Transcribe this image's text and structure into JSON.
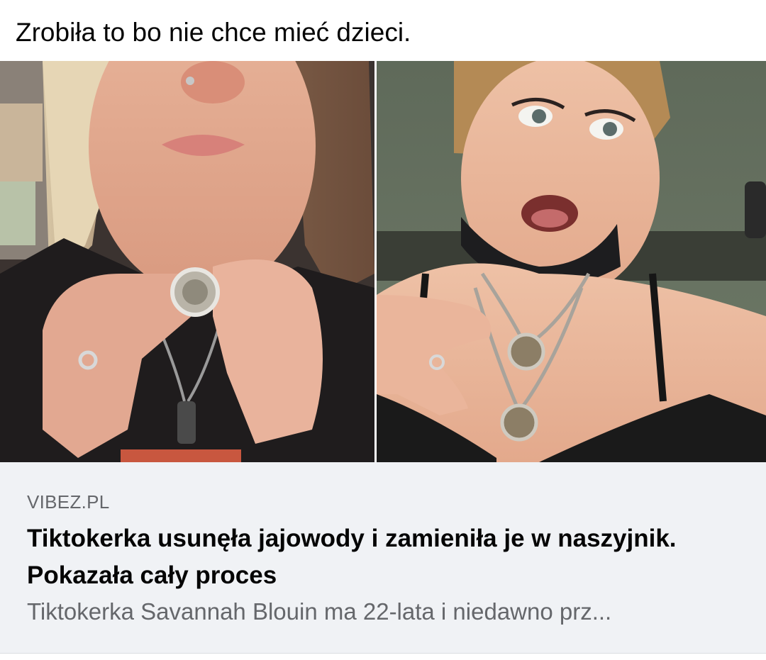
{
  "post": {
    "caption": "Zrobiła to bo nie chce mieć dzieci."
  },
  "media": {
    "left_image_icon": "photo-woman-holding-pendant",
    "right_image_icon": "photo-woman-surprised-necklace"
  },
  "link_card": {
    "domain": "VIBEZ.PL",
    "title": "Tiktokerka usunęła jajowody i zamieniła je w naszyjnik. Pokazała cały proces",
    "description": "Tiktokerka Savannah Blouin ma 22-lata i niedawno prz...",
    "background_color": "#f0f2f5"
  }
}
